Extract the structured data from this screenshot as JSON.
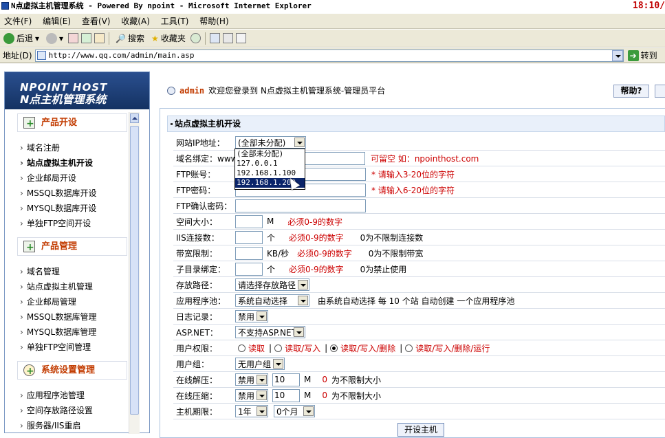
{
  "window": {
    "title": "N点虚拟主机管理系统 - Powered By npoint - Microsoft Internet Explorer",
    "clock": "18:10/"
  },
  "menu": [
    "文件(F)",
    "编辑(E)",
    "查看(V)",
    "收藏(A)",
    "工具(T)",
    "帮助(H)"
  ],
  "toolbar": {
    "back": "后退",
    "search": "搜索",
    "favorites": "收藏夹"
  },
  "address": {
    "label": "地址(D)",
    "url": "http://www.qq.com/admin/main.asp",
    "go": "转到"
  },
  "logo": {
    "line1": "NPOINT HOST",
    "line2": "N点主机管理系统"
  },
  "sidebar": {
    "sections": [
      {
        "title": "产品开设",
        "items": [
          "域名注册",
          "站点虚拟主机开设",
          "企业邮局开设",
          "MSSQL数据库开设",
          "MYSQL数据库开设",
          "单独FTP空间开设"
        ]
      },
      {
        "title": "产品管理",
        "items": [
          "域名管理",
          "站点虚拟主机管理",
          "企业邮局管理",
          "MSSQL数据库管理",
          "MYSQL数据库管理",
          "单独FTP空间管理"
        ]
      },
      {
        "title": "系统设置管理",
        "items": [
          "应用程序池管理",
          "空间存放路径设置",
          "服务器/IIS重启"
        ]
      }
    ]
  },
  "top": {
    "user": "admin",
    "welcome": "欢迎您登录到 N点虚拟主机管理系统-管理员平台",
    "help": "帮助?"
  },
  "panel": {
    "title": "站点虚拟主机开设"
  },
  "form": {
    "ip_label": "网站IP地址：",
    "ip_value": "(全部未分配)",
    "ip_options": [
      "(全部未分配)",
      "127.0.0.1",
      "192.168.1.100",
      "192.168.1.200"
    ],
    "domain_label": "域名绑定：www.",
    "domain_hint": "可留空 如：npointhost.com",
    "ftp_user_label": "FTP账号：",
    "ftp_user_hint": "* 请输入3-20位的字符",
    "ftp_pass_label": "FTP密码：",
    "ftp_pass_hint": "* 请输入6-20位的字符",
    "ftp_confirm_label": "FTP确认密码：",
    "space_label": "空间大小：",
    "space_unit": "M",
    "space_hint": "必须0-9的数字",
    "iis_label": "IIS连接数：",
    "iis_unit": "个",
    "iis_hint": "必须0-9的数字",
    "iis_note": "0为不限制连接数",
    "bw_label": "带宽限制：",
    "bw_unit": "KB/秒",
    "bw_hint": "必须0-9的数字",
    "bw_note": "0为不限制带宽",
    "subdir_label": "子目录绑定：",
    "subdir_unit": "个",
    "subdir_hint": "必须0-9的数字",
    "subdir_note": "0为禁止使用",
    "path_label": "存放路径：",
    "path_value": "请选择存放路径",
    "pool_label": "应用程序池：",
    "pool_value": "系统自动选择",
    "pool_note": "由系统自动选择  每 10 个站 自动创建 一个应用程序池",
    "log_label": "日志记录：",
    "log_value": "禁用",
    "asp_label": "ASP.NET：",
    "asp_value": "不支持ASP.NET",
    "perm_label": "用户权限：",
    "perm_options": [
      "读取",
      "读取/写入",
      "读取/写入/删除",
      "读取/写入/删除/运行"
    ],
    "group_label": "用户组：",
    "group_value": "无用户组",
    "unzip_label": "在线解压：",
    "unzip_value": "禁用",
    "unzip_size": "10",
    "unzip_unit": "M",
    "unzip_zero": "0",
    "unzip_note": "为不限制大小",
    "zip_label": "在线压缩：",
    "zip_value": "禁用",
    "zip_size": "10",
    "zip_unit": "M",
    "zip_zero": "0",
    "zip_note": "为不限制大小",
    "term_label": "主机期限：",
    "term_year": "1年",
    "term_month": "0个月",
    "submit": "开设主机"
  }
}
